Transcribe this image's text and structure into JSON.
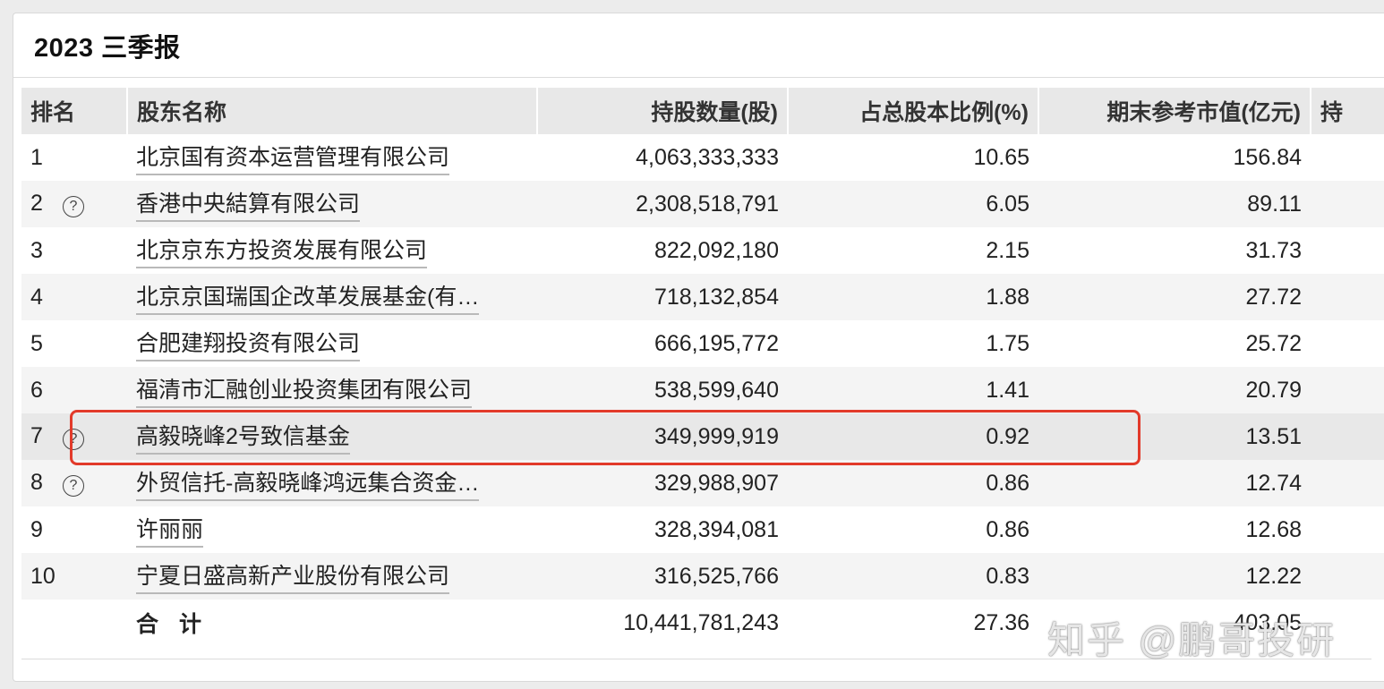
{
  "report": {
    "title": "2023 三季报"
  },
  "table": {
    "headers": {
      "rank": "排名",
      "name": "股东名称",
      "shares": "持股数量(股)",
      "ratio": "占总股本比例(%)",
      "value": "期末参考市值(亿元)",
      "extra": "持"
    },
    "rows": [
      {
        "rank": "1",
        "name": "北京国有资本运营管理有限公司",
        "shares": "4,063,333,333",
        "ratio": "10.65",
        "value": "156.84",
        "help": false
      },
      {
        "rank": "2",
        "name": "香港中央結算有限公司",
        "shares": "2,308,518,791",
        "ratio": "6.05",
        "value": "89.11",
        "help": true
      },
      {
        "rank": "3",
        "name": "北京京东方投资发展有限公司",
        "shares": "822,092,180",
        "ratio": "2.15",
        "value": "31.73",
        "help": false
      },
      {
        "rank": "4",
        "name": "北京京国瑞国企改革发展基金(有…",
        "shares": "718,132,854",
        "ratio": "1.88",
        "value": "27.72",
        "help": false
      },
      {
        "rank": "5",
        "name": "合肥建翔投资有限公司",
        "shares": "666,195,772",
        "ratio": "1.75",
        "value": "25.72",
        "help": false
      },
      {
        "rank": "6",
        "name": "福清市汇融创业投资集团有限公司",
        "shares": "538,599,640",
        "ratio": "1.41",
        "value": "20.79",
        "help": false
      },
      {
        "rank": "7",
        "name": "高毅晓峰2号致信基金",
        "shares": "349,999,919",
        "ratio": "0.92",
        "value": "13.51",
        "help": true
      },
      {
        "rank": "8",
        "name": "外贸信托-高毅晓峰鸿远集合资金…",
        "shares": "329,988,907",
        "ratio": "0.86",
        "value": "12.74",
        "help": true
      },
      {
        "rank": "9",
        "name": "许丽丽",
        "shares": "328,394,081",
        "ratio": "0.86",
        "value": "12.68",
        "help": false
      },
      {
        "rank": "10",
        "name": "宁夏日盛高新产业股份有限公司",
        "shares": "316,525,766",
        "ratio": "0.83",
        "value": "12.22",
        "help": false
      }
    ],
    "total": {
      "label": "合 计",
      "shares": "10,441,781,243",
      "ratio": "27.36",
      "value": "403.05"
    }
  },
  "help_icon_glyph": "?",
  "watermark": "知乎 @鹏哥投研",
  "colors": {
    "highlight_border": "#e23a2a",
    "header_bg": "#e8e8e8",
    "alt_row_bg": "#f4f4f4"
  }
}
